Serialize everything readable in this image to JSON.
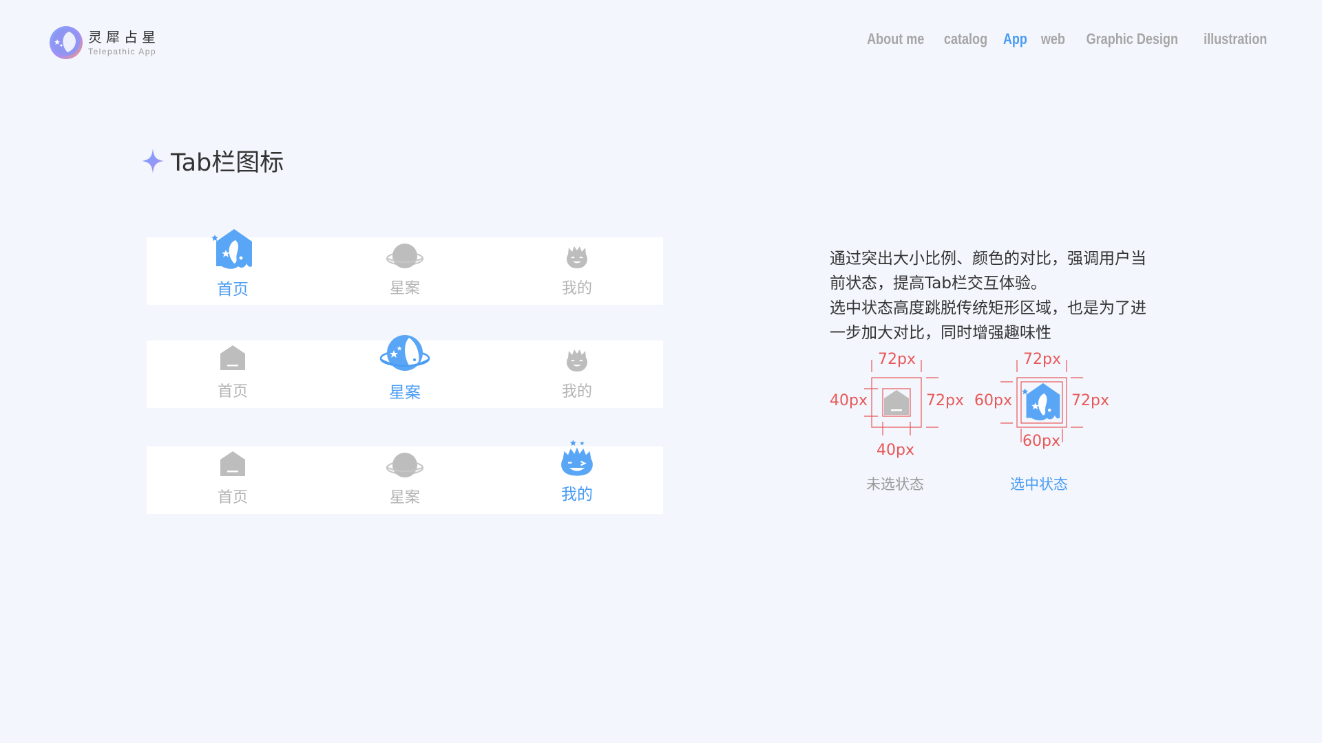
{
  "logo": {
    "name_cn": "灵犀占星",
    "name_en": "Telepathic App"
  },
  "nav": {
    "items": [
      {
        "label": "About me",
        "active": false
      },
      {
        "label": "catalog",
        "active": false
      },
      {
        "label": "App",
        "active": true
      },
      {
        "label": "web",
        "active": false
      },
      {
        "label": "Graphic Design",
        "active": false
      },
      {
        "label": "illustration",
        "active": false
      }
    ]
  },
  "section": {
    "title": "Tab栏图标"
  },
  "tabbars": [
    {
      "selected": 0,
      "tabs": [
        {
          "label": "首页",
          "icon": "home-icon"
        },
        {
          "label": "星案",
          "icon": "planet-icon"
        },
        {
          "label": "我的",
          "icon": "profile-icon"
        }
      ]
    },
    {
      "selected": 1,
      "tabs": [
        {
          "label": "首页",
          "icon": "home-icon"
        },
        {
          "label": "星案",
          "icon": "planet-icon"
        },
        {
          "label": "我的",
          "icon": "profile-icon"
        }
      ]
    },
    {
      "selected": 2,
      "tabs": [
        {
          "label": "首页",
          "icon": "home-icon"
        },
        {
          "label": "星案",
          "icon": "planet-icon"
        },
        {
          "label": "我的",
          "icon": "profile-icon"
        }
      ]
    }
  ],
  "description": {
    "line1": "通过突出大小比例、颜色的对比，强调用户当",
    "line2": "前状态，提高Tab栏交互体验。",
    "line3": "选中状态高度跳脱传统矩形区域，也是为了进",
    "line4": "一步加大对比，同时增强趣味性"
  },
  "spec": {
    "unselected": {
      "outer": "72px",
      "outer_side": "72px",
      "inner": "40px",
      "inner_bottom": "40px",
      "caption": "未选状态"
    },
    "selected": {
      "outer": "72px",
      "outer_side": "72px",
      "inner": "60px",
      "inner_bottom": "60px",
      "caption": "选中状态"
    }
  },
  "colors": {
    "accent": "#4a9cf4",
    "inactive": "#b3b3b3",
    "spec": "#e85858",
    "background": "#f3f6fc"
  }
}
